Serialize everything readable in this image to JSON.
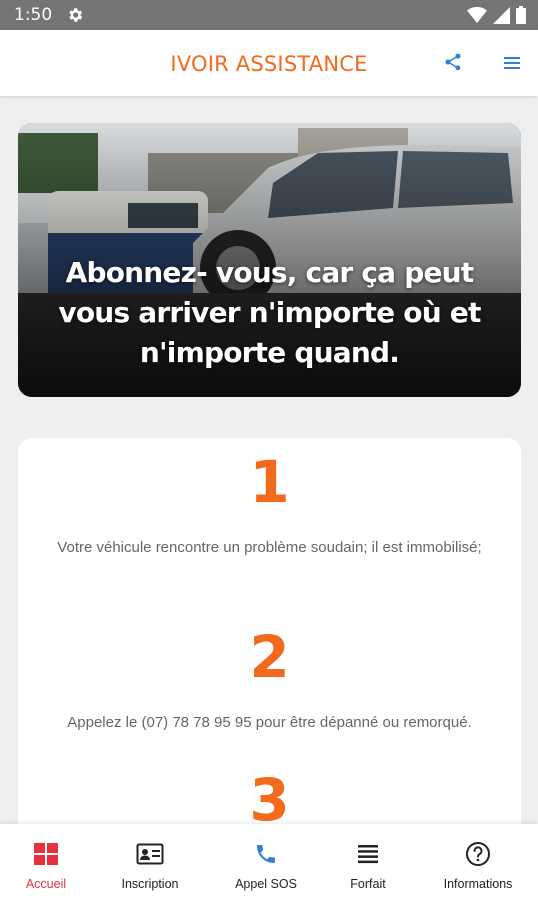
{
  "status_bar": {
    "time": "1:50"
  },
  "app_bar": {
    "title": "IVOIR ASSISTANCE"
  },
  "hero": {
    "text": "Abonnez- vous, car ça peut vous arriver n'importe où et n'importe quand."
  },
  "steps": [
    {
      "number": "1",
      "text": "Votre véhicule rencontre un problème soudain; il est immobilisé;"
    },
    {
      "number": "2",
      "text": "Appelez le (07) 78 78 95 95 pour être dépanné ou remorqué."
    },
    {
      "number": "3",
      "text": ""
    }
  ],
  "bottom_nav": {
    "items": [
      {
        "label": "Accueil",
        "icon": "grid-icon",
        "active": true
      },
      {
        "label": "Inscription",
        "icon": "id-card-icon",
        "active": false
      },
      {
        "label": "Appel SOS",
        "icon": "phone-icon",
        "active": false
      },
      {
        "label": "Forfait",
        "icon": "list-icon",
        "active": false
      },
      {
        "label": "Informations",
        "icon": "help-icon",
        "active": false
      }
    ]
  },
  "colors": {
    "accent": "#f26a1b",
    "active_nav": "#e8313c",
    "share_icon": "#2f7fd8",
    "phone_icon": "#2f7fd8"
  }
}
